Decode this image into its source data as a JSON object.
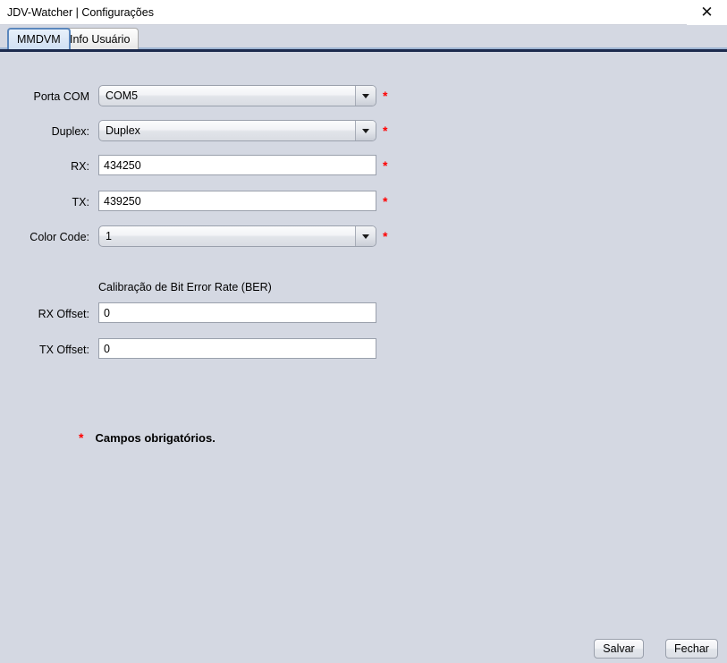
{
  "window": {
    "title": "JDV-Watcher | Configurações",
    "close_icon": "close-icon",
    "close_glyph": "✕"
  },
  "tabs": [
    {
      "label": "MMDVM",
      "selected": true
    },
    {
      "label": "Info Usuário",
      "selected": false
    }
  ],
  "form": {
    "fields": [
      {
        "label": "Porta COM",
        "type": "combo",
        "value": "COM5",
        "required": true,
        "star": "*"
      },
      {
        "label": "Duplex:",
        "type": "combo",
        "value": "Duplex",
        "required": true,
        "star": "*"
      },
      {
        "label": "RX:",
        "type": "text",
        "value": "434250",
        "required": true,
        "star": "*"
      },
      {
        "label": "TX:",
        "type": "text",
        "value": "439250",
        "required": true,
        "star": "*"
      },
      {
        "label": "Color Code:",
        "type": "combo",
        "value": "1",
        "required": true,
        "star": "*"
      }
    ]
  },
  "ber_section": {
    "header": "Calibração de Bit Error Rate (BER)",
    "fields": [
      {
        "label": "RX Offset:",
        "type": "text",
        "value": "0"
      },
      {
        "label": "TX Offset:",
        "type": "text",
        "value": "0"
      }
    ]
  },
  "mandatory": {
    "star": "*",
    "text": "Campos obrigatórios."
  },
  "footer": {
    "save_label": "Salvar",
    "close_label": "Fechar"
  },
  "colors": {
    "background": "#d4d8e2",
    "titlebar": "#ffffff",
    "accent_line": "#1c2a4d",
    "tab_selected_border": "#5b87bd",
    "required_star": "#ff0000"
  }
}
